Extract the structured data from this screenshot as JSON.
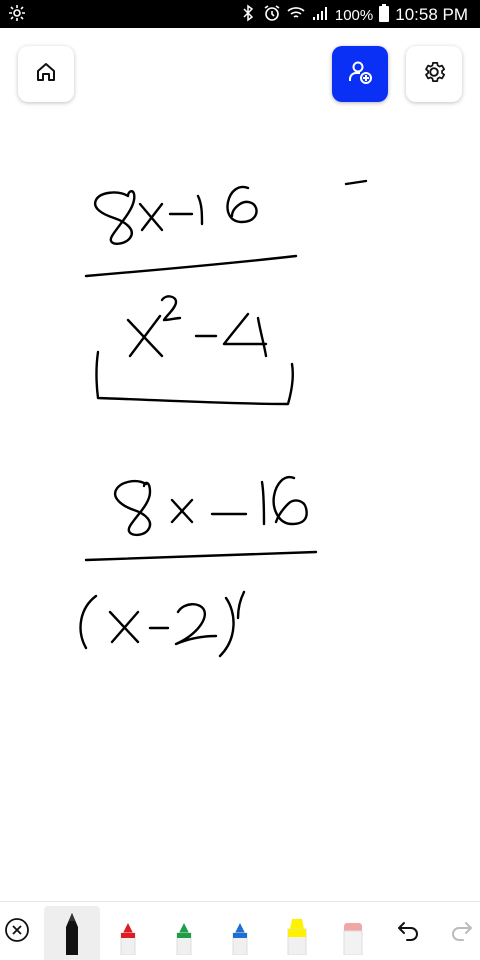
{
  "status_bar": {
    "battery_percent": "100%",
    "time": "10:58 PM",
    "icons": [
      "notification-icon",
      "bluetooth-icon",
      "alarm-icon",
      "wifi-icon",
      "signal-icon",
      "battery-icon"
    ]
  },
  "top_bar": {
    "home_icon": "home-icon",
    "add_user_icon": "add-user-icon",
    "settings_icon": "gear-icon",
    "accent_color": "#0a2ff5"
  },
  "toolbar": {
    "tools": [
      {
        "name": "close",
        "icon": "close-circle-icon"
      },
      {
        "name": "black-pen",
        "color": "#111111",
        "selected": true
      },
      {
        "name": "red-pen",
        "color": "#e01b24"
      },
      {
        "name": "green-pen",
        "color": "#1e9e48"
      },
      {
        "name": "blue-pen",
        "color": "#1f6fd1"
      },
      {
        "name": "highlighter",
        "color": "#fff200"
      },
      {
        "name": "eraser",
        "color": "#f2a7a7"
      },
      {
        "name": "undo",
        "icon": "undo-icon"
      },
      {
        "name": "redo",
        "icon": "redo-icon"
      }
    ]
  }
}
